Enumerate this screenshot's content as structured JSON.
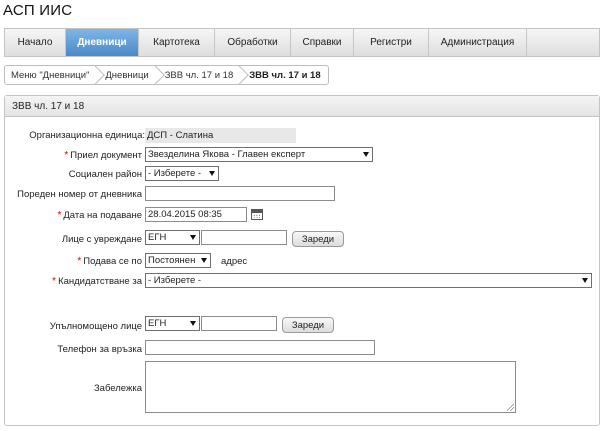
{
  "app": {
    "title": "АСП ИИС"
  },
  "nav": {
    "items": [
      {
        "label": "Начало"
      },
      {
        "label": "Дневници"
      },
      {
        "label": "Картотека"
      },
      {
        "label": "Обработки"
      },
      {
        "label": "Справки"
      },
      {
        "label": "Регистри"
      },
      {
        "label": "Администрация"
      }
    ],
    "active": "Дневници"
  },
  "breadcrumb": [
    {
      "label": "Меню \"Дневници\""
    },
    {
      "label": "Дневници"
    },
    {
      "label": "ЗВВ чл. 17 и 18"
    },
    {
      "label": "ЗВВ чл. 17 и 18"
    }
  ],
  "panel": {
    "title": "ЗВВ чл. 17 и 18"
  },
  "form": {
    "org_unit": {
      "label": "Организационна единица:",
      "value": "ДСП - Слатина"
    },
    "received_doc": {
      "label": "Приел документ",
      "value": "Звезделина Якова - Главен експерт",
      "required": "*"
    },
    "social_region": {
      "label": "Социален район",
      "value": "- Изберете -"
    },
    "journal_number": {
      "label": "Пореден номер от дневника",
      "value": ""
    },
    "submission_date": {
      "label": "Дата на подаване",
      "value": "28.04.2015 08:35",
      "required": "*"
    },
    "injured_person": {
      "label": "Лице с увреждане",
      "id_type": "ЕГН",
      "value": "",
      "button": "Зареди"
    },
    "submitted_by": {
      "label": "Подава се по",
      "value": "Постоянен",
      "suffix": "адрес",
      "required": "*"
    },
    "application_for": {
      "label": "Кандидатстване за",
      "value": "- Изберете -",
      "required": "*"
    },
    "authorized_person": {
      "label": "Упълномощено лице",
      "id_type": "ЕГН",
      "value": "",
      "button": "Зареди"
    },
    "phone": {
      "label": "Телефон за връзка",
      "value": ""
    },
    "note": {
      "label": "Забележка",
      "value": ""
    }
  },
  "icons": {
    "calendar": "calendar-icon",
    "dropdown": "chevron-down-icon"
  },
  "colors": {
    "nav_active": "#4a88c8",
    "required": "#d40000"
  }
}
